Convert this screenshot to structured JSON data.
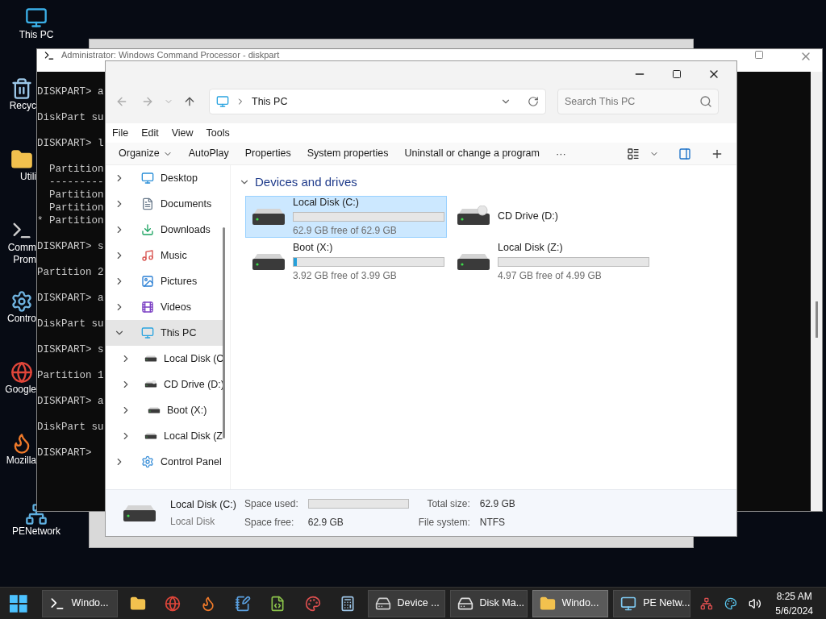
{
  "desktop_icons": [
    {
      "kind": "pc",
      "lines": [
        "This PC"
      ]
    },
    {
      "kind": "bin",
      "lines": [
        "Recyc"
      ]
    },
    {
      "kind": "folder",
      "lines": [
        "Utili"
      ]
    },
    {
      "kind": "cmd",
      "lines": [
        "Comm",
        "Prom"
      ]
    },
    {
      "kind": "control",
      "lines": [
        "Contro"
      ]
    },
    {
      "kind": "chrome",
      "lines": [
        "Google"
      ]
    },
    {
      "kind": "firefox",
      "lines": [
        "Mozilla"
      ]
    },
    {
      "kind": "network",
      "lines": [
        "PENetwork"
      ]
    }
  ],
  "cmd_window": {
    "title": "Administrator: Windows Command Processor - diskpart",
    "blocks": [
      [
        "DISKPART> a"
      ],
      [
        "DiskPart su"
      ],
      [
        "DISKPART> l"
      ],
      [
        "  Partition",
        "  ---------",
        "  Partition",
        "  Partition",
        "* Partition"
      ],
      [
        "DISKPART> s"
      ],
      [
        "Partition 2"
      ],
      [
        "DISKPART> a"
      ],
      [
        "DiskPart su"
      ],
      [
        "DISKPART> s"
      ],
      [
        "Partition 1"
      ],
      [
        "DISKPART> a"
      ],
      [
        "DiskPart su"
      ],
      [
        "DISKPART>"
      ]
    ]
  },
  "explorer": {
    "address": "This PC",
    "search": {
      "placeholder": "Search This PC"
    },
    "menu": [
      "File",
      "Edit",
      "View",
      "Tools"
    ],
    "commands": [
      {
        "label": "Organize",
        "dropdown": true
      },
      {
        "label": "AutoPlay",
        "dropdown": false
      },
      {
        "label": "Properties",
        "dropdown": false
      },
      {
        "label": "System properties",
        "dropdown": false
      },
      {
        "label": "Uninstall or change a program",
        "dropdown": false
      }
    ],
    "more": "···",
    "sidebar": [
      {
        "label": "Desktop",
        "kind": "desktop",
        "expanded": false,
        "selected": false
      },
      {
        "label": "Documents",
        "kind": "documents",
        "expanded": false,
        "selected": false
      },
      {
        "label": "Downloads",
        "kind": "downloads",
        "expanded": false,
        "selected": false
      },
      {
        "label": "Music",
        "kind": "music",
        "expanded": false,
        "selected": false
      },
      {
        "label": "Pictures",
        "kind": "pictures",
        "expanded": false,
        "selected": false
      },
      {
        "label": "Videos",
        "kind": "videos",
        "expanded": false,
        "selected": false
      },
      {
        "label": "This PC",
        "kind": "pc",
        "expanded": true,
        "selected": true,
        "children": [
          {
            "label": "Local Disk (C",
            "kind": "disk",
            "expanded": false,
            "selected": false
          },
          {
            "label": "CD Drive (D:)",
            "kind": "cd",
            "expanded": false,
            "selected": false
          },
          {
            "label": "Boot (X:)",
            "kind": "disk",
            "expanded": false,
            "selected": false
          },
          {
            "label": "Local Disk (Z",
            "kind": "disk",
            "expanded": false,
            "selected": false
          }
        ]
      },
      {
        "label": "Control Panel",
        "kind": "control",
        "expanded": false,
        "selected": false
      }
    ],
    "section": {
      "title": "Devices and drives",
      "expanded": true
    },
    "drives": [
      {
        "name": "Local Disk (C:)",
        "kind": "disk",
        "selected": true,
        "level": 0,
        "free": "62.9 GB free of 62.9 GB"
      },
      {
        "name": "CD Drive (D:)",
        "kind": "cd",
        "selected": false
      },
      {
        "name": "Boot (X:)",
        "kind": "disk",
        "selected": false,
        "level": 0.02,
        "free": "3.92 GB free of 3.99 GB"
      },
      {
        "name": "Local Disk (Z:)",
        "kind": "disk",
        "selected": false,
        "level": 0,
        "free": "4.97 GB free of 4.99 GB"
      }
    ],
    "details": {
      "name": "Local Disk (C:)",
      "type": "Local Disk",
      "used_label": "Space used:",
      "usage": {
        "level": 0
      },
      "free_label": "Space free:",
      "free_value": "62.9 GB",
      "total_label": "Total size:",
      "total_value": "62.9 GB",
      "fs_label": "File system:",
      "fs_value": "NTFS"
    }
  },
  "taskbar": {
    "items": [
      {
        "kind": "cmd",
        "label": "Windo...",
        "active": false
      },
      {
        "kind": "folder"
      },
      {
        "kind": "chrome"
      },
      {
        "kind": "firefox"
      },
      {
        "kind": "notepad"
      },
      {
        "kind": "editor"
      },
      {
        "kind": "paint"
      },
      {
        "kind": "calculator"
      },
      {
        "kind": "device",
        "label": "Device ...",
        "active": false
      },
      {
        "kind": "disk",
        "label": "Disk Ma...",
        "active": false
      },
      {
        "kind": "folder",
        "label": "Windo...",
        "active": true
      },
      {
        "kind": "network",
        "label": "PE Netw...",
        "active": false
      }
    ],
    "time": "8:25 AM",
    "date": "5/6/2024"
  }
}
